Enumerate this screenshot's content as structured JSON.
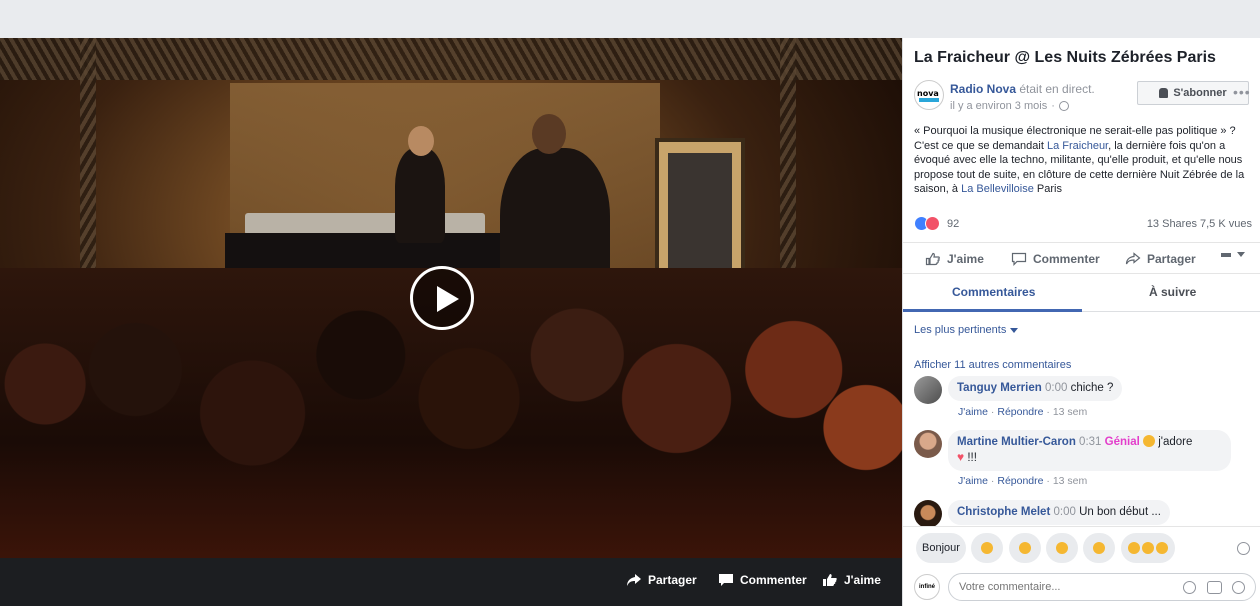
{
  "video": {
    "actions": {
      "share": "Partager",
      "comment": "Commenter",
      "like": "J'aime"
    }
  },
  "post": {
    "title": "La Fraicheur @ Les Nuits Zébrées Paris",
    "author": "Radio Nova",
    "live_text": "était en direct.",
    "time": "il y a environ 3 mois",
    "subscribe_label": "S'abonner",
    "logo_text": "nova",
    "description": {
      "part1": "« Pourquoi la musique électronique ne serait-elle pas politique » ? C'est ce que se demandait ",
      "link1": "La Fraicheur",
      "part2": ", la dernière fois qu'on a évoqué avec elle la techno, militante, qu'elle produit, et qu'elle nous propose tout de suite, en clôture de cette dernière Nuit Zébrée de la saison, à ",
      "link2": "La Bellevilloise",
      "part3": " Paris"
    },
    "reactions_count": "92",
    "shares_views": "13 Shares  7,5 K vues",
    "actions": {
      "like": "J'aime",
      "comment": "Commenter",
      "share": "Partager"
    }
  },
  "tabs": {
    "comments": "Commentaires",
    "follow": "À suivre"
  },
  "sort_label": "Les plus pertinents",
  "show_more": "Afficher 11 autres commentaires",
  "comments": [
    {
      "name": "Tanguy Merrien",
      "timestamp": "0:00",
      "text": "chiche ?",
      "like": "J'aime",
      "reply": "Répondre",
      "age": "13 sem"
    },
    {
      "name": "Martine Multier-Caron",
      "timestamp": "0:31",
      "genial": "Génial",
      "text": "j'adore",
      "text2": "!!!",
      "like": "J'aime",
      "reply": "Répondre",
      "age": "13 sem"
    },
    {
      "name": "Christophe Melet",
      "timestamp": "0:00",
      "text": "Un bon début ..."
    }
  ],
  "quick_replies": [
    "Bonjour"
  ],
  "composer": {
    "avatar_text": "infiné",
    "placeholder": "Votre commentaire..."
  },
  "colors": {
    "link": "#365899",
    "accent": "#4267b2",
    "genial": "#e33ecb"
  }
}
